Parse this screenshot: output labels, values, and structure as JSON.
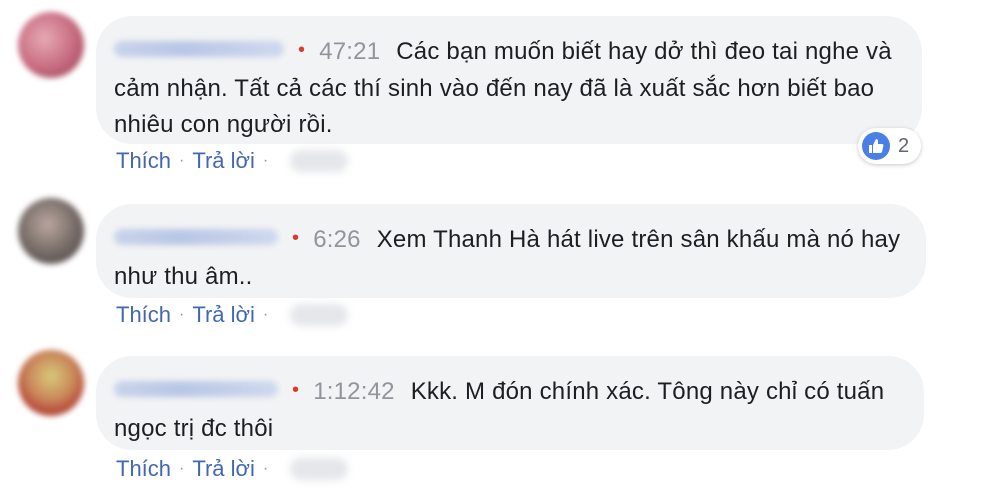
{
  "comments": [
    {
      "time": "47:21",
      "text": "Các bạn muốn biết hay dở thì đeo tai nghe và cảm nhận. Tất cả các thí sinh vào đến nay đã là xuất sắc hơn biết bao nhiêu con người rồi.",
      "like_label": "Thích",
      "reply_label": "Trả lời",
      "reaction_count": "2",
      "reaction_icon": "thumbs-up-icon"
    },
    {
      "time": "6:26",
      "text": "Xem Thanh Hà hát live trên sân khấu mà nó hay như thu âm..",
      "like_label": "Thích",
      "reply_label": "Trả lời"
    },
    {
      "time": "1:12:42",
      "text": "Kkk. M đón chính xác. Tông này chỉ có tuấn ngọc trị đc thôi",
      "like_label": "Thích",
      "reply_label": "Trả lời"
    }
  ],
  "colors": {
    "link": "#4267b2",
    "bubble": "#f2f3f5",
    "timestamp": "#90949c",
    "live_dot": "#e0392b",
    "like_badge": "#4a7fe5"
  }
}
